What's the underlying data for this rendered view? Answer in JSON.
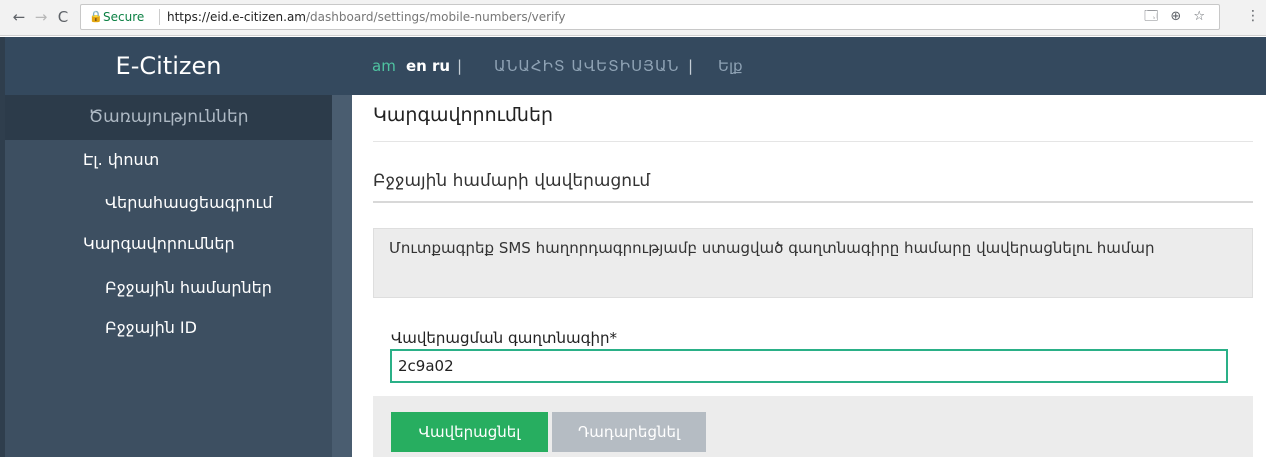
{
  "browser": {
    "back_icon": "←",
    "forward_icon": "→",
    "reload_icon": "C",
    "lock_icon": "🔒",
    "secure_label": "Secure",
    "url_host": "https://eid.e-citizen.am",
    "url_path": "/dashboard/settings/mobile-numbers/verify",
    "right_icons": "🗔 ⊕ ☆",
    "menu_icon": "⋮"
  },
  "sidebar": {
    "brand": "E-Citizen",
    "services": "Ծառայություններ",
    "items": [
      {
        "label": "Էլ. փոստ"
      },
      {
        "label": "Վերահասցեագրում"
      },
      {
        "label": "Կարգավորումներ"
      },
      {
        "label": "Բջջային համարներ"
      },
      {
        "label": "Բջջային ID"
      }
    ]
  },
  "topbar": {
    "lang_am": "am",
    "lang_en": "en",
    "lang_ru": "ru",
    "divider": "|",
    "username": "ԱՆԱՀԻՏ ԱՎԵՏԻՍՅԱՆ",
    "logout": "Ելք"
  },
  "main": {
    "title": "Կարգավորումներ",
    "subtitle": "Բջջային համարի վավերացում",
    "info": "Մուտքագրեք SMS հաղորդագրությամբ ստացված գաղտնագիրը համարը վավերացնելու համար",
    "field_label": "Վավերացման գաղտնագիր*",
    "field_value": "2c9a02",
    "verify_button": "Վավերացնել",
    "cancel_button": "Դադարեցնել"
  },
  "colors": {
    "sidebar_bg": "#3d4f61",
    "topbar_bg": "#34495e",
    "accent_green": "#27ae60",
    "input_border": "#2ab087"
  }
}
